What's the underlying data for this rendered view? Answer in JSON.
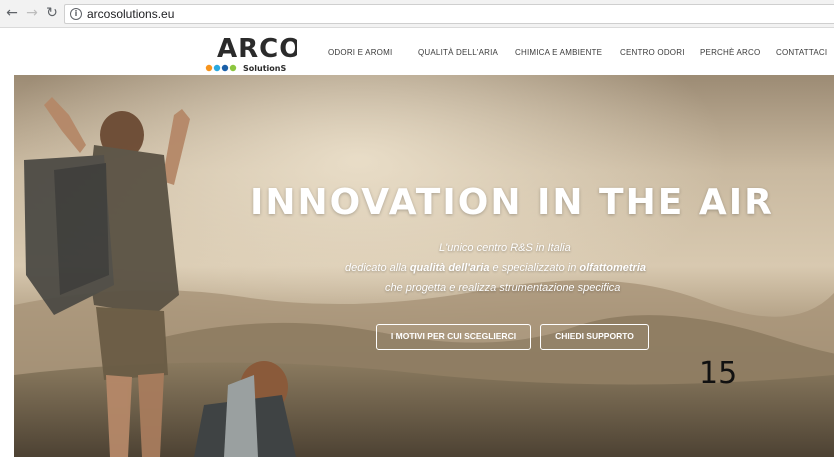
{
  "browser": {
    "url": "arcosolutions.eu",
    "back_icon": "arrow-left-icon",
    "forward_icon": "arrow-right-icon",
    "reload_icon": "reload-icon",
    "info_icon": "info-icon"
  },
  "header": {
    "logo": {
      "text": "ARCO",
      "subtext": "SolutionS"
    },
    "nav": [
      {
        "label": "ODORI E AROMI"
      },
      {
        "label": "QUALITÀ DELL'ARIA"
      },
      {
        "label": "CHIMICA E AMBIENTE"
      },
      {
        "label": "CENTRO ODORI"
      },
      {
        "label": "PERCHÈ ARCO"
      },
      {
        "label": "CONTATTACI"
      }
    ]
  },
  "hero": {
    "title": "INNOVATION IN THE AIR",
    "line1": "L'unico centro R&S in Italia",
    "line2_pre": "dedicato alla ",
    "line2_bold1": "qualità dell'aria",
    "line2_mid": " e specializzato in ",
    "line2_bold2": "olfattometria",
    "line3": "che progetta e realizza strumentazione specifica",
    "button_primary": "I MOTIVI PER CUI SCEGLIERCI",
    "button_secondary": "CHIEDI SUPPORTO",
    "overlay_number": "15"
  },
  "colors": {
    "logo_dark": "#2b2b2b",
    "logo_green": "#8cc63f",
    "logo_blue": "#29a9e1",
    "logo_orange": "#f7941d",
    "hero_title": "#ffffff"
  }
}
